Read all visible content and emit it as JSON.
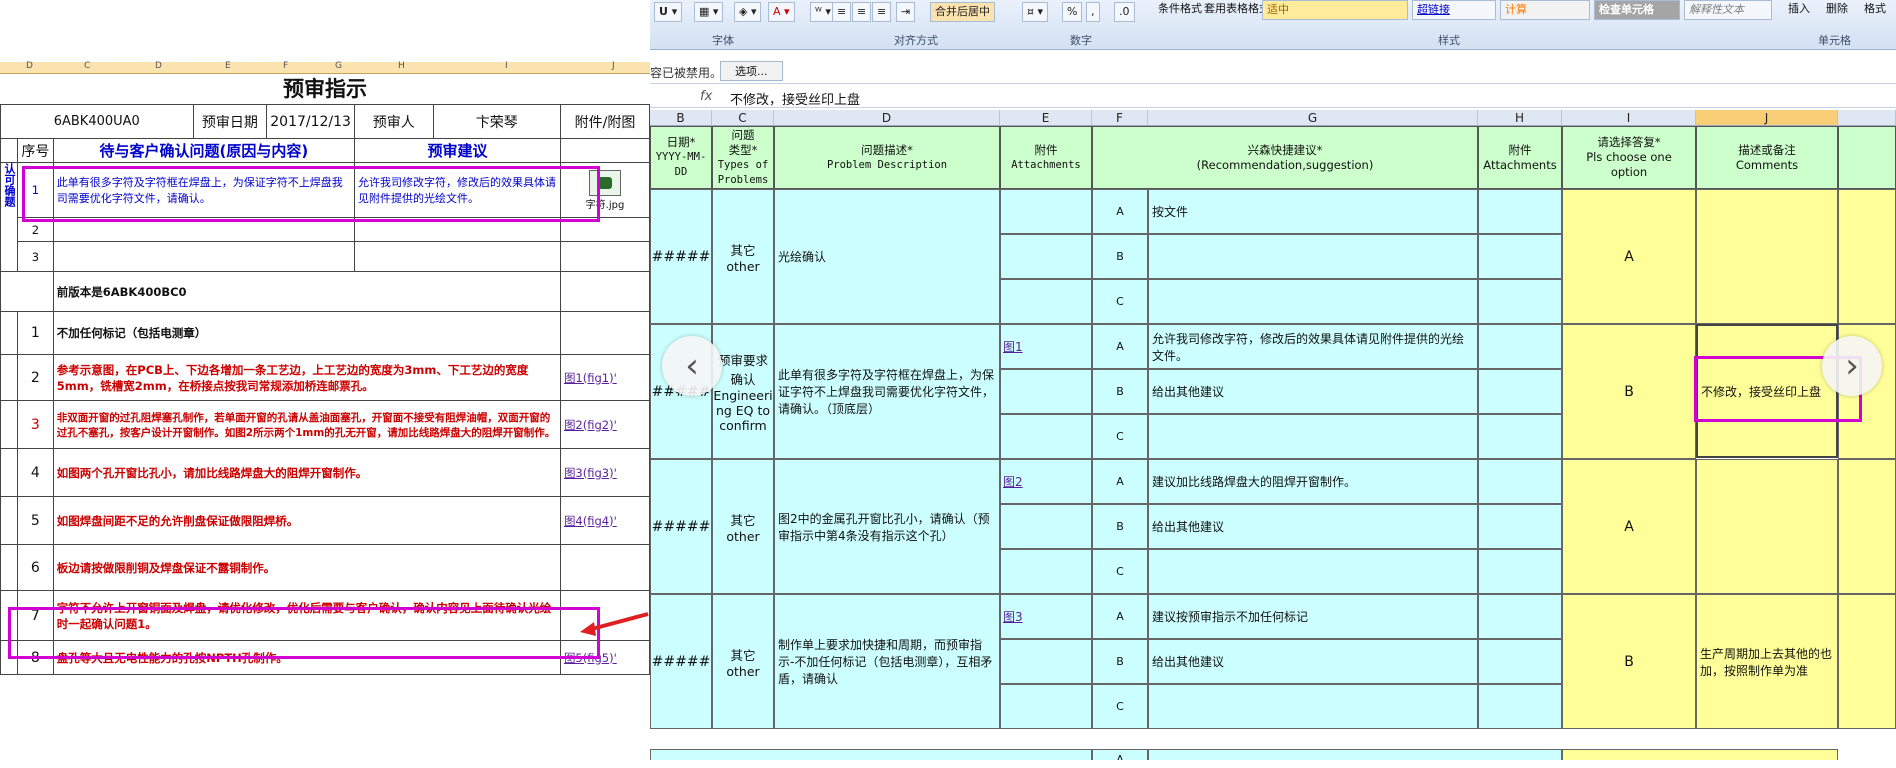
{
  "left": {
    "col_letters": [
      "D",
      "C",
      "D",
      "E",
      "F",
      "G",
      "H",
      "I",
      "J"
    ],
    "title": "预审指示",
    "info": {
      "model": "6ABK400UA0",
      "date_label": "预审日期",
      "date": "2017/12/13",
      "person_label": "预审人",
      "person": "卞荣琴",
      "attach_label": "附件/附图"
    },
    "headers": {
      "seq": "序号",
      "issue": "待与客户确认问题(原因与内容)",
      "advice": "预审建议"
    },
    "side_label": "认可确题",
    "confirm_rows": [
      {
        "no": "1",
        "issue": "此单有很多字符及字符框在焊盘上，为保证字符不上焊盘我司需要优化字符文件，请确认。",
        "advice": "允许我司修改字符，修改后的效果具体请见附件提供的光绘文件。",
        "attach": "字符.jpg"
      },
      {
        "no": "2",
        "issue": "",
        "advice": "",
        "attach": ""
      },
      {
        "no": "3",
        "issue": "",
        "advice": "",
        "attach": ""
      }
    ],
    "prev_version": "前版本是6ABK400BC0",
    "rows": [
      {
        "no": "1",
        "text": "不加任何标记（包括电测章）",
        "link": "",
        "style": "black"
      },
      {
        "no": "2",
        "text": "参考示意图，在PCB上、下边各增加一条工艺边，上工艺边的宽度为3mm、下工艺边的宽度5mm，铣槽宽2mm，在桥接点按我司常规添加桥连邮票孔。",
        "link": "图1(fig1)'",
        "style": "red"
      },
      {
        "no": "3",
        "text": "非双面开窗的过孔阻焊塞孔制作，若单面开窗的孔请从盖油面塞孔，开窗面不接受有阻焊油帽，双面开窗的过孔不塞孔，按客户设计开窗制作。如图2所示两个1mm的孔无开窗，请加比线路焊盘大的阻焊开窗制作。",
        "link": "图2(fig2)'",
        "style": "red"
      },
      {
        "no": "4",
        "text": "如图两个孔开窗比孔小，请加比线路焊盘大的阻焊开窗制作。",
        "link": "图3(fig3)'",
        "style": "red"
      },
      {
        "no": "5",
        "text": "如图焊盘间距不足的允许削盘保证做限阻焊桥。",
        "link": "图4(fig4)'",
        "style": "red"
      },
      {
        "no": "6",
        "text": "板边请按做限削铜及焊盘保证不露铜制作。",
        "link": "",
        "style": "red"
      },
      {
        "no": "7",
        "text": "字符不允许上开窗铜面及焊盘，请优化修改，优化后需要与客户确认，确认内容见上面待确认光绘时一起确认问题1。",
        "link": "",
        "style": "red"
      },
      {
        "no": "8",
        "text": "盘孔等大且无电性能力的孔按NPTH孔制作。",
        "link": "图5(fig5)'",
        "style": "red"
      }
    ]
  },
  "right": {
    "ribbon": {
      "groups": [
        "字体",
        "对齐方式",
        "数字",
        "样式",
        "单元格"
      ],
      "buttons": {
        "merge": "合并后居中",
        "cond_format": "条件格式",
        "table_format": "套用表格格式",
        "neutral": "适中",
        "hyperlink": "超链接",
        "calc": "计算",
        "check_cell": "检查单元格",
        "explain": "解释性文本",
        "insert": "插入",
        "delete": "删除",
        "format": "格式",
        "percent": "%"
      }
    },
    "message": {
      "text": "容已被禁用。",
      "option": "选项..."
    },
    "formula": {
      "fx": "fx",
      "value": "不修改，接受丝印上盘"
    },
    "col_letters": [
      "B",
      "C",
      "D",
      "E",
      "F",
      "G",
      "H",
      "I",
      "J"
    ],
    "headers": {
      "date": [
        "日期*",
        "YYYY-MM-",
        "DD"
      ],
      "type": [
        "问题",
        "类型*",
        "Types of",
        "Problems"
      ],
      "desc": [
        "问题描述*",
        "Problem Description"
      ],
      "attach": [
        "附件",
        "Attachments"
      ],
      "sugg": [
        "兴森快捷建议*",
        "(Recommendation,suggestion)"
      ],
      "attach2": [
        "附件",
        "Attachments"
      ],
      "choose": [
        "请选择答复*",
        "Pls choose one",
        "option"
      ],
      "comment": [
        "描述或备注",
        "Comments"
      ]
    },
    "groups": [
      {
        "date": "#####",
        "type": [
          "其它",
          "other"
        ],
        "desc": "光绘确认",
        "link": "",
        "opts": [
          {
            "l": "A",
            "t": "按文件"
          },
          {
            "l": "B",
            "t": ""
          },
          {
            "l": "C",
            "t": ""
          }
        ],
        "answer": "A",
        "comment": ""
      },
      {
        "date": "#####",
        "type": [
          "预审要求",
          "确认",
          "Engineeri",
          "ng EQ to",
          "confirm"
        ],
        "desc": "此单有很多字符及字符框在焊盘上，为保证字符不上焊盘我司需要优化字符文件，请确认。（顶底层）",
        "link": "图1",
        "opts": [
          {
            "l": "A",
            "t": "允许我司修改字符，修改后的效果具体请见附件提供的光绘文件。"
          },
          {
            "l": "B",
            "t": "给出其他建议"
          },
          {
            "l": "C",
            "t": ""
          }
        ],
        "answer": "B",
        "comment": "不修改，接受丝印上盘"
      },
      {
        "date": "#####",
        "type": [
          "其它",
          "other"
        ],
        "desc": "图2中的金属孔开窗比孔小，请确认（预审指示中第4条没有指示这个孔）",
        "link": "图2",
        "opts": [
          {
            "l": "A",
            "t": "建议加比线路焊盘大的阻焊开窗制作。"
          },
          {
            "l": "B",
            "t": "给出其他建议"
          },
          {
            "l": "C",
            "t": ""
          }
        ],
        "answer": "A",
        "comment": ""
      },
      {
        "date": "#####",
        "type": [
          "其它",
          "other"
        ],
        "desc": "制作单上要求加快捷和周期，而预审指示-不加任何标记（包括电测章），互相矛盾，请确认",
        "link": "图3",
        "opts": [
          {
            "l": "A",
            "t": "建议按预审指示不加任何标记"
          },
          {
            "l": "B",
            "t": "给出其他建议"
          },
          {
            "l": "C",
            "t": ""
          }
        ],
        "answer": "B",
        "comment": "生产周期加上去其他的也加，按照制作单为准"
      }
    ],
    "last_opt": "A",
    "nav": {
      "prev": "‹",
      "next": "›"
    }
  },
  "colors": {
    "magenta": "#d200d2",
    "cyan": "#ccffff",
    "yellow": "#ffff99",
    "green": "#ccffcc",
    "red": "#cc0000"
  }
}
